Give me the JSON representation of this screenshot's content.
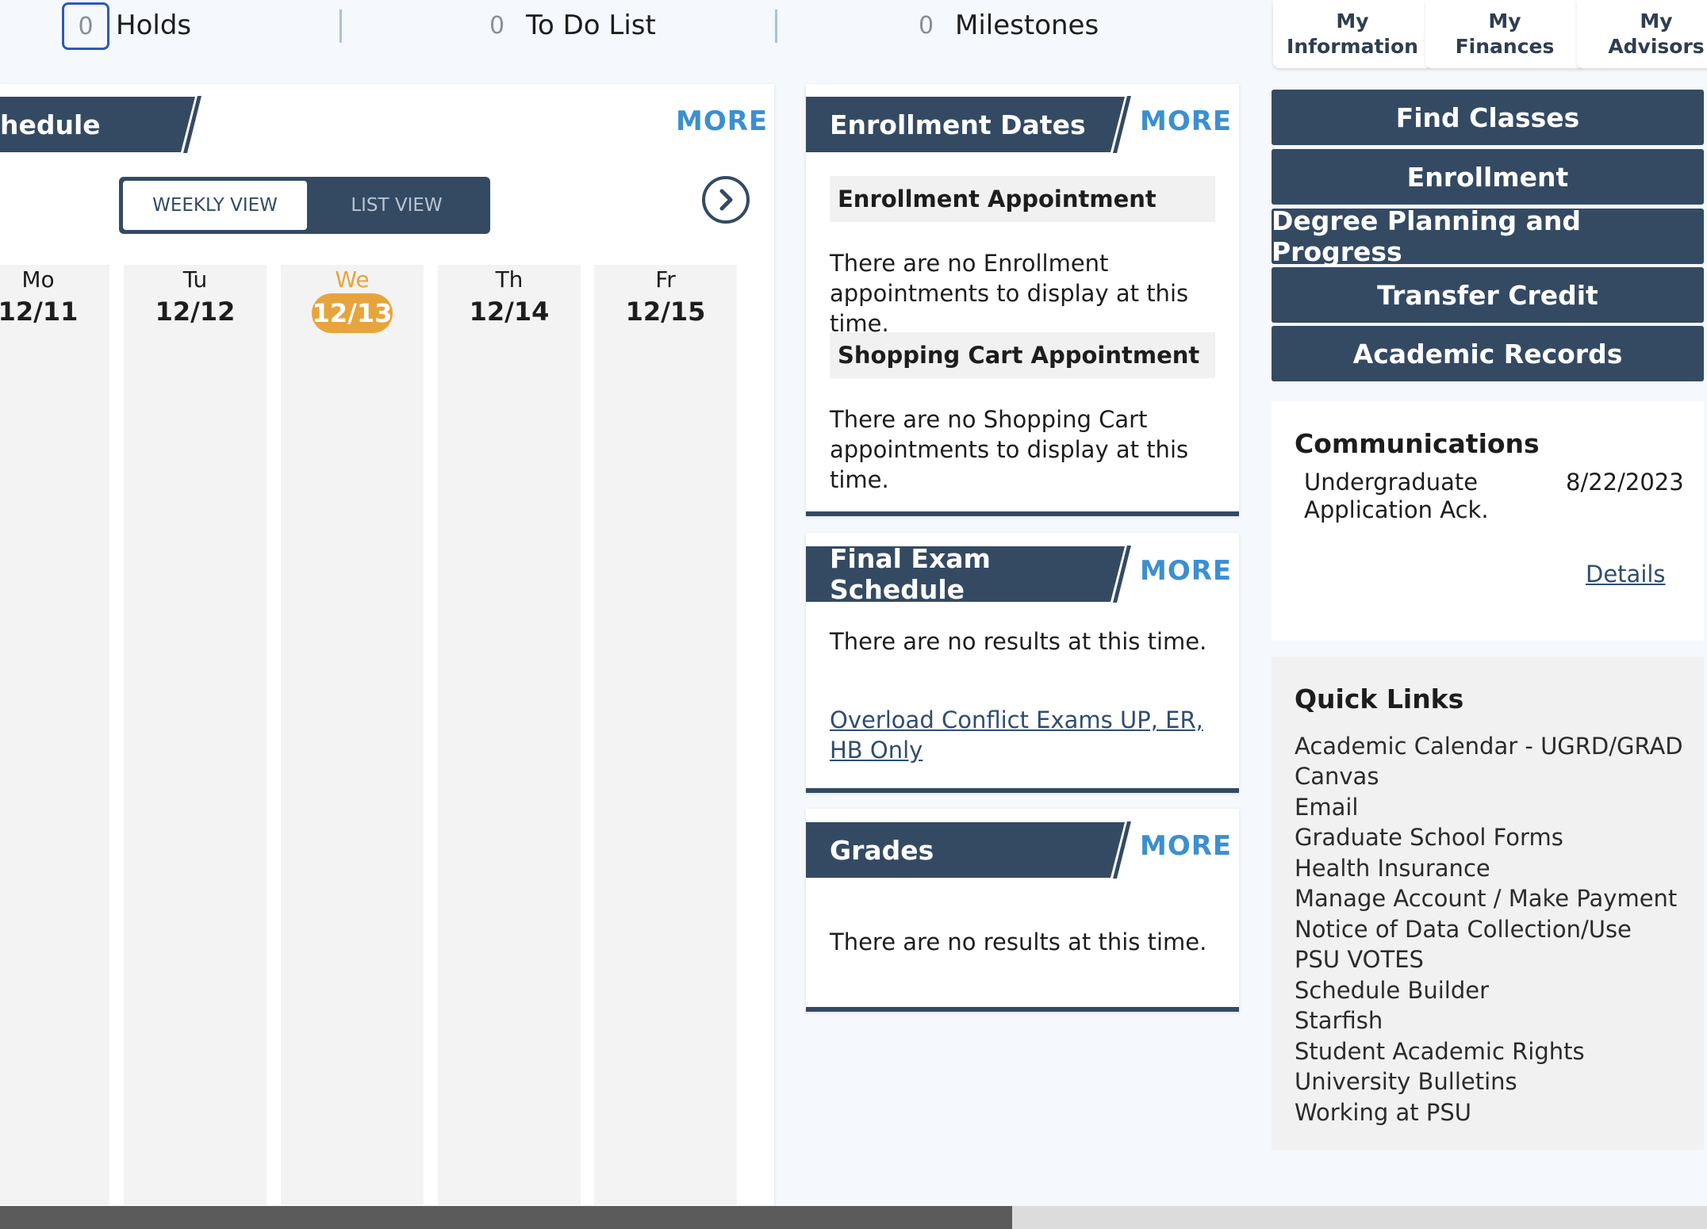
{
  "status": {
    "holds": {
      "count": "0",
      "label": "Holds"
    },
    "todo": {
      "count": "0",
      "label": "To Do List"
    },
    "milestones": {
      "count": "0",
      "label": "Milestones"
    }
  },
  "top_buttons": [
    {
      "label": "My\nInformation"
    },
    {
      "label": "My\nFinances"
    },
    {
      "label": "My\nAdvisors"
    }
  ],
  "schedule": {
    "title": "hedule",
    "more": "MORE",
    "weekly_view": "WEEKLY VIEW",
    "list_view": "LIST VIEW",
    "days": [
      {
        "name": "Mo",
        "date": "12/11"
      },
      {
        "name": "Tu",
        "date": "12/12"
      },
      {
        "name": "We",
        "date": "12/13"
      },
      {
        "name": "Th",
        "date": "12/14"
      },
      {
        "name": "Fr",
        "date": "12/15"
      }
    ]
  },
  "enrollment_dates": {
    "title": "Enrollment Dates",
    "more": "MORE",
    "appointment_heading": "Enrollment Appointment",
    "appointment_text": "There are no Enrollment appointments to display at this time.",
    "cart_heading": "Shopping Cart Appointment",
    "cart_text": "There are no Shopping Cart appointments to display at this time."
  },
  "final_exam": {
    "title": "Final Exam Schedule",
    "more": "MORE",
    "text": "There are no results at this time.",
    "link": "Overload Conflict Exams UP, ER, HB Only"
  },
  "grades": {
    "title": "Grades",
    "more": "MORE",
    "text": "There are no results at this time."
  },
  "nav_menu": [
    {
      "label": "Find Classes"
    },
    {
      "label": "Enrollment"
    },
    {
      "label": "Degree Planning and Progress"
    },
    {
      "label": "Transfer Credit"
    },
    {
      "label": "Academic Records"
    }
  ],
  "communications": {
    "title": "Communications",
    "item": "Undergraduate Application Ack.",
    "date": "8/22/2023",
    "details": "Details"
  },
  "quick_links": {
    "title": "Quick Links",
    "items": [
      "Academic Calendar - UGRD/GRAD",
      "Canvas",
      "Email",
      "Graduate School Forms",
      "Health Insurance",
      "Manage Account / Make Payment",
      "Notice of Data Collection/Use",
      "PSU VOTES",
      "Schedule Builder",
      "Starfish",
      "Student Academic Rights",
      "University Bulletins",
      "Working at PSU"
    ]
  },
  "colors": {
    "navy": "#344a63",
    "accent_blue": "#3c8fcf",
    "today_orange": "#e8a43c"
  }
}
